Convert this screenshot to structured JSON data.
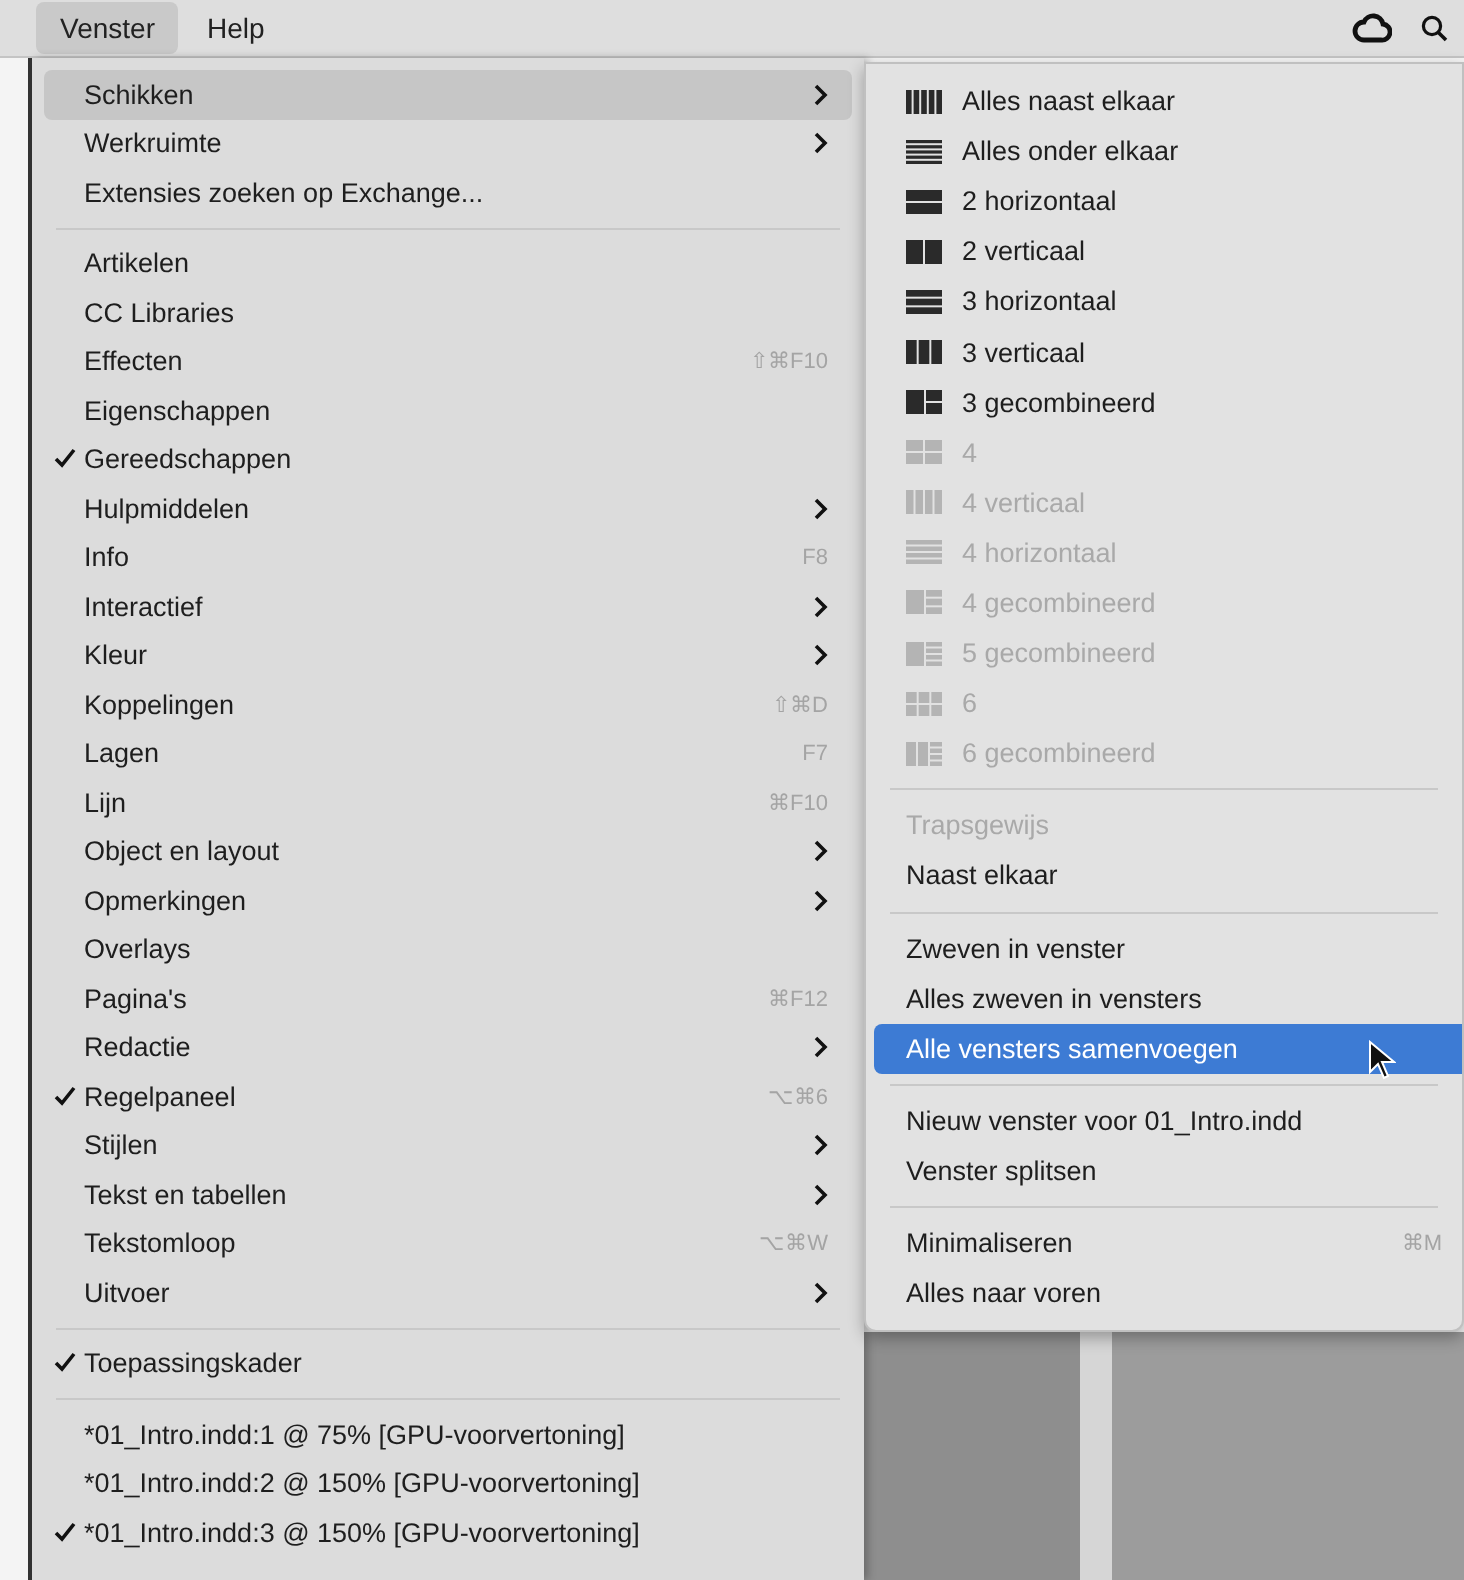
{
  "menubar": {
    "items": [
      {
        "label": "Venster",
        "selected": true
      },
      {
        "label": "Help",
        "selected": false
      }
    ]
  },
  "window_menu": {
    "sections": [
      [
        {
          "label": "Schikken",
          "submenu": true,
          "checked": false,
          "selected": true
        },
        {
          "label": "Werkruimte",
          "submenu": true,
          "checked": false,
          "selected": false
        },
        {
          "label": "Extensies zoeken op Exchange...",
          "submenu": false,
          "checked": false,
          "selected": false
        }
      ],
      [
        {
          "label": "Artikelen",
          "submenu": false,
          "checked": false,
          "selected": false
        },
        {
          "label": "CC Libraries",
          "submenu": false,
          "checked": false,
          "selected": false
        },
        {
          "label": "Effecten",
          "shortcut": "⇧⌘F10",
          "submenu": false,
          "checked": false,
          "selected": false
        },
        {
          "label": "Eigenschappen",
          "submenu": false,
          "checked": false,
          "selected": false
        },
        {
          "label": "Gereedschappen",
          "submenu": false,
          "checked": true,
          "selected": false
        },
        {
          "label": "Hulpmiddelen",
          "submenu": true,
          "checked": false,
          "selected": false
        },
        {
          "label": "Info",
          "shortcut": "F8",
          "submenu": false,
          "checked": false,
          "selected": false
        },
        {
          "label": "Interactief",
          "submenu": true,
          "checked": false,
          "selected": false
        },
        {
          "label": "Kleur",
          "submenu": true,
          "checked": false,
          "selected": false
        },
        {
          "label": "Koppelingen",
          "shortcut": "⇧⌘D",
          "submenu": false,
          "checked": false,
          "selected": false
        },
        {
          "label": "Lagen",
          "shortcut": "F7",
          "submenu": false,
          "checked": false,
          "selected": false
        },
        {
          "label": "Lijn",
          "shortcut": "⌘F10",
          "submenu": false,
          "checked": false,
          "selected": false
        },
        {
          "label": "Object en layout",
          "submenu": true,
          "checked": false,
          "selected": false
        },
        {
          "label": "Opmerkingen",
          "submenu": true,
          "checked": false,
          "selected": false
        },
        {
          "label": "Overlays",
          "submenu": false,
          "checked": false,
          "selected": false
        },
        {
          "label": "Pagina's",
          "shortcut": "⌘F12",
          "submenu": false,
          "checked": false,
          "selected": false
        },
        {
          "label": "Redactie",
          "submenu": true,
          "checked": false,
          "selected": false
        },
        {
          "label": "Regelpaneel",
          "shortcut": "⌥⌘6",
          "submenu": false,
          "checked": true,
          "selected": false
        },
        {
          "label": "Stijlen",
          "submenu": true,
          "checked": false,
          "selected": false
        },
        {
          "label": "Tekst en tabellen",
          "submenu": true,
          "checked": false,
          "selected": false
        },
        {
          "label": "Tekstomloop",
          "shortcut": "⌥⌘W",
          "submenu": false,
          "checked": false,
          "selected": false
        },
        {
          "label": "Uitvoer",
          "submenu": true,
          "checked": false,
          "selected": false
        }
      ],
      [
        {
          "label": "Toepassingskader",
          "submenu": false,
          "checked": true,
          "selected": false
        }
      ],
      [
        {
          "label": "*01_Intro.indd:1 @ 75% [GPU-voorvertoning]",
          "submenu": false,
          "checked": false,
          "selected": false
        },
        {
          "label": "*01_Intro.indd:2 @ 150% [GPU-voorvertoning]",
          "submenu": false,
          "checked": false,
          "selected": false
        },
        {
          "label": "*01_Intro.indd:3 @ 150% [GPU-voorvertoning]",
          "submenu": false,
          "checked": true,
          "selected": false
        }
      ]
    ]
  },
  "arrange_submenu": {
    "sections": [
      [
        {
          "kind": "cols5",
          "label": "Alles naast elkaar",
          "disabled": false,
          "selected": false
        },
        {
          "kind": "rows5",
          "label": "Alles onder elkaar",
          "disabled": false,
          "selected": false
        },
        {
          "kind": "rows2",
          "label": "2 horizontaal",
          "disabled": false,
          "selected": false
        },
        {
          "kind": "cols2",
          "label": "2 verticaal",
          "disabled": false,
          "selected": false
        },
        {
          "kind": "rows3",
          "label": "3 horizontaal",
          "disabled": false,
          "selected": false
        },
        {
          "kind": "cols3",
          "label": "3 verticaal",
          "disabled": false,
          "selected": false
        },
        {
          "kind": "combo3",
          "label": "3 gecombineerd",
          "disabled": false,
          "selected": false
        },
        {
          "kind": "grid4",
          "label": "4",
          "disabled": true,
          "selected": false
        },
        {
          "kind": "cols4",
          "label": "4 verticaal",
          "disabled": true,
          "selected": false
        },
        {
          "kind": "rows4",
          "label": "4 horizontaal",
          "disabled": true,
          "selected": false
        },
        {
          "kind": "combo4",
          "label": "4 gecombineerd",
          "disabled": true,
          "selected": false
        },
        {
          "kind": "combo5",
          "label": "5 gecombineerd",
          "disabled": true,
          "selected": false
        },
        {
          "kind": "grid6",
          "label": "6",
          "disabled": true,
          "selected": false
        },
        {
          "kind": "combo6",
          "label": "6 gecombineerd",
          "disabled": true,
          "selected": false
        }
      ],
      [
        {
          "kind": "plain",
          "label": "Trapsgewijs",
          "disabled": true,
          "selected": false
        },
        {
          "kind": "plain",
          "label": "Naast elkaar",
          "disabled": false,
          "selected": false
        }
      ],
      [
        {
          "kind": "plain",
          "label": "Zweven in venster",
          "disabled": false,
          "selected": false
        },
        {
          "kind": "plain",
          "label": "Alles zweven in vensters",
          "disabled": false,
          "selected": false
        },
        {
          "kind": "plain",
          "label": "Alle vensters samenvoegen",
          "disabled": false,
          "selected": true
        }
      ],
      [
        {
          "kind": "plain",
          "label": "Nieuw venster voor 01_Intro.indd",
          "disabled": false,
          "selected": false
        },
        {
          "kind": "plain",
          "label": "Venster splitsen",
          "disabled": false,
          "selected": false
        }
      ],
      [
        {
          "kind": "plain",
          "label": "Minimaliseren",
          "shortcut": "⌘M",
          "disabled": false,
          "selected": false
        },
        {
          "kind": "plain",
          "label": "Alles naar voren",
          "disabled": false,
          "selected": false
        }
      ]
    ]
  }
}
